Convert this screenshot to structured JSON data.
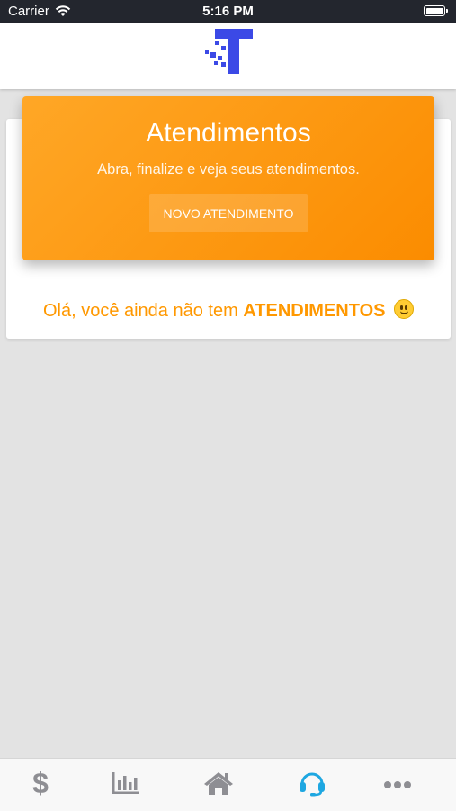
{
  "status_bar": {
    "carrier": "Carrier",
    "time": "5:16 PM"
  },
  "header": {
    "logo_icon": "brand-t-logo-icon",
    "logo_color": "#3b49e6"
  },
  "hero": {
    "title": "Atendimentos",
    "subtitle": "Abra, finalize e veja seus atendimentos.",
    "button_label": "NOVO ATENDIMENTO",
    "gradient_from": "#ffa726",
    "gradient_to": "#fb8c00"
  },
  "empty_state": {
    "message_prefix": "Olá, você ainda não tem ",
    "message_bold": "ATENDIMENTOS",
    "emoji_icon": "smile-emoji-icon",
    "color": "#ff9800"
  },
  "tabbar": {
    "active_color": "#1ea7e1",
    "inactive_color": "#8e8e93",
    "items": [
      {
        "icon": "dollar-icon",
        "active": false
      },
      {
        "icon": "bar-chart-icon",
        "active": false
      },
      {
        "icon": "home-icon",
        "active": false
      },
      {
        "icon": "headset-icon",
        "active": true
      },
      {
        "icon": "more-icon",
        "active": false
      }
    ]
  }
}
